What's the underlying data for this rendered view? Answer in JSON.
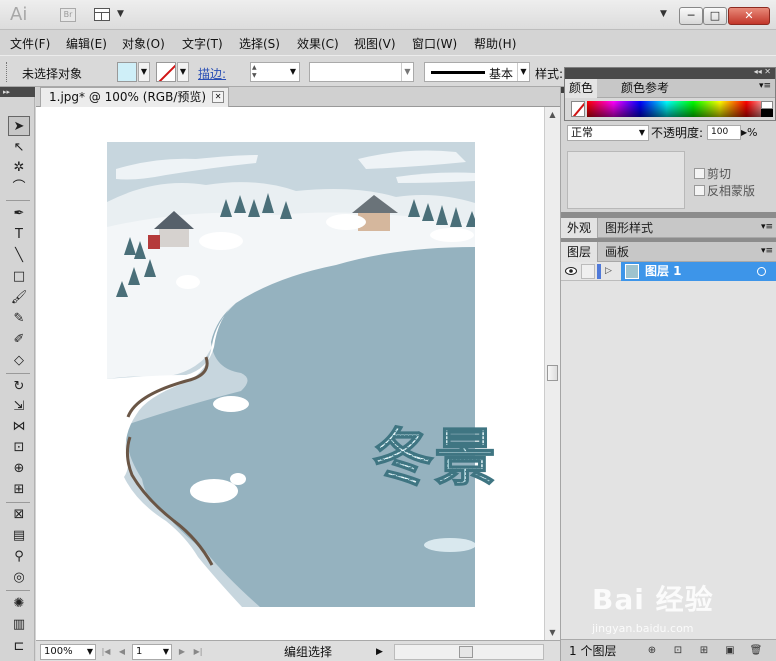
{
  "window": {
    "app_logo": "Ai",
    "bridge_label": "Br",
    "minimize_label": "─",
    "maximize_label": "□",
    "close_label": "✕"
  },
  "menu": [
    "文件(F)",
    "编辑(E)",
    "对象(O)",
    "文字(T)",
    "选择(S)",
    "效果(C)",
    "视图(V)",
    "窗口(W)",
    "帮助(H)"
  ],
  "control_bar": {
    "selection_status": "未选择对象",
    "fill_color": "#cfeff8",
    "stroke_label": "描边:",
    "brush_label": "基本",
    "style_label": "样式:"
  },
  "document": {
    "tab_title": "1.jpg* @ 100% (RGB/预览)",
    "artwork_text": "冬景",
    "canvas_background": "#ffffff",
    "lake_color": "#95b2bf"
  },
  "status_bar": {
    "zoom": "100%",
    "page": "1",
    "status_text": "编组选择"
  },
  "color_panel": {
    "tabs": [
      "颜色",
      "颜色参考"
    ]
  },
  "transparency_panel": {
    "blend_mode": "正常",
    "opacity_label": "不透明度:",
    "opacity_value": "100",
    "opacity_unit": "%",
    "clip_label": "剪切",
    "invert_mask_label": "反相蒙版"
  },
  "appearance_panel": {
    "tabs": [
      "外观",
      "图形样式"
    ]
  },
  "layers_panel": {
    "tabs": [
      "图层",
      "画板"
    ],
    "layers": [
      {
        "name": "图层 1",
        "color": "#4f79d9",
        "selected": true
      }
    ],
    "count_label": "1 个图层"
  },
  "watermark": {
    "text": "Bai 经验",
    "sub": "jingyan.baidu.com"
  }
}
